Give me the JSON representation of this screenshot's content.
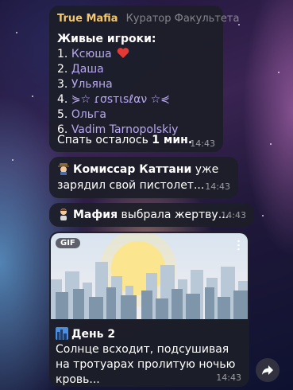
{
  "message1": {
    "sender": "True Mafia",
    "role": "Куратор Факультета",
    "heading": "Живые игроки:",
    "players": [
      {
        "num": "1.",
        "name": "Ксюша",
        "emoji": "heart"
      },
      {
        "num": "2.",
        "name": "Даша"
      },
      {
        "num": "3.",
        "name": "Ульяна"
      },
      {
        "num": "4.",
        "name": "⋟☆ ɾσѕтιѕℓαν ☆⋞"
      },
      {
        "num": "5.",
        "name": "Ольга"
      },
      {
        "num": "6.",
        "name": "Vadim Tarnopolskiy"
      }
    ],
    "sleep_prefix": "Спать осталось ",
    "sleep_value": "1 мин.",
    "time": "14:43"
  },
  "message2": {
    "icon": "detective-icon",
    "bold": "Комиссар Каттани",
    "text": " уже зарядил свой пистолет...",
    "time": "14:43"
  },
  "message3": {
    "icon": "mafia-person-icon",
    "bold": "Мафия",
    "text": " выбрала жертву...",
    "time": "14:43"
  },
  "message4": {
    "badge": "GIF",
    "icon": "city-sunrise-icon",
    "title": "День 2",
    "text": "Солнце всходит, подсушивая на тротуарах пролитую ночью кровь...",
    "time": "14:43"
  },
  "colors": {
    "sender": "#f2c66d",
    "player_name": "#b9a8f2",
    "bubble_bg": "#1c1e28"
  }
}
